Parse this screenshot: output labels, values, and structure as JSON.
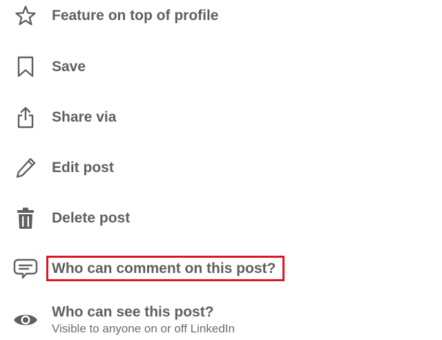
{
  "menu": {
    "items": [
      {
        "icon": "star-icon",
        "label": "Feature on top of profile"
      },
      {
        "icon": "bookmark-icon",
        "label": "Save"
      },
      {
        "icon": "share-icon",
        "label": "Share via"
      },
      {
        "icon": "pencil-icon",
        "label": "Edit post"
      },
      {
        "icon": "trash-icon",
        "label": "Delete post"
      },
      {
        "icon": "comment-icon",
        "label": "Who can comment on this post?"
      },
      {
        "icon": "eye-icon",
        "label": "Who can see this post?",
        "sublabel": "Visible to anyone on or off LinkedIn"
      }
    ]
  },
  "colors": {
    "text": "#5f5f5f",
    "highlight_border": "#e0141e",
    "background": "#ffffff"
  }
}
